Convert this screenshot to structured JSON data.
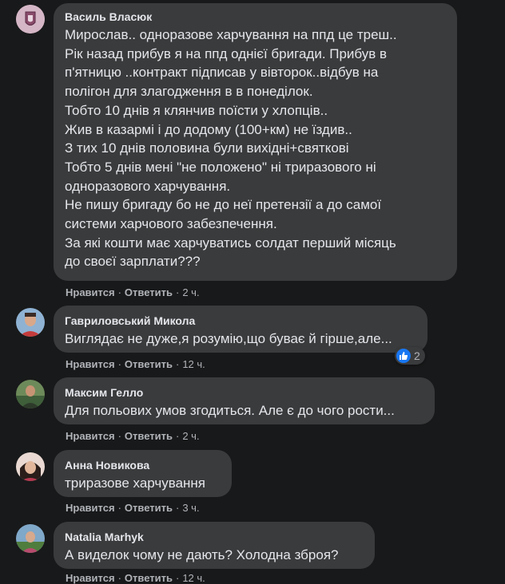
{
  "comments": [
    {
      "author": "Василь Власюк",
      "text": "Мирослав.. одноразове харчування на ппд це треш..\nРік назад прибув я на ппд однієї бригади. Прибув в\nп'ятницю ..контракт підписав у вівторок..відбув на\nполігон для злагодження в в понеділок.\nТобто 10 днів я клянчив поїсти у хлопців..\nЖив в казармі і до додому (100+км) не їздив..\nЗ тих 10 днів половина були вихідні+святкові\nТобто 5 днів мені \"не положено\" ні триразового ні\nодноразового харчування.\nНе пишу бригаду бо не до неї претензії а до самої\nсистеми харчового забезпечення.\nЗа які кошти має харчуватись солдат перший місяць\nдо своєї зарплати???",
      "like": "Нравится",
      "reply": "Ответить",
      "time": "2 ч."
    },
    {
      "author": "Гавриловський Микола",
      "text": "Виглядає не дуже,я розумію,що буває й гірше,але...",
      "like": "Нравится",
      "reply": "Ответить",
      "time": "12 ч.",
      "reaction_count": "2"
    },
    {
      "author": "Максим Гелло",
      "text": "Для польових умов згодиться. Але є до чого рости...",
      "like": "Нравится",
      "reply": "Ответить",
      "time": "2 ч."
    },
    {
      "author": "Анна Новикова",
      "text": "триразове харчування",
      "like": "Нравится",
      "reply": "Ответить",
      "time": "3 ч."
    },
    {
      "author": "Natalia Marhyk",
      "text": "А виделок чому не дають? Холодна зброя?",
      "like": "Нравится",
      "reply": "Ответить",
      "time": "12 ч."
    }
  ],
  "separator": "·",
  "colors": {
    "background": "#18191a",
    "bubble": "#3a3b3c",
    "text": "#e4e6eb",
    "secondary": "#b0b3b8",
    "like_blue": "#1877f2"
  }
}
